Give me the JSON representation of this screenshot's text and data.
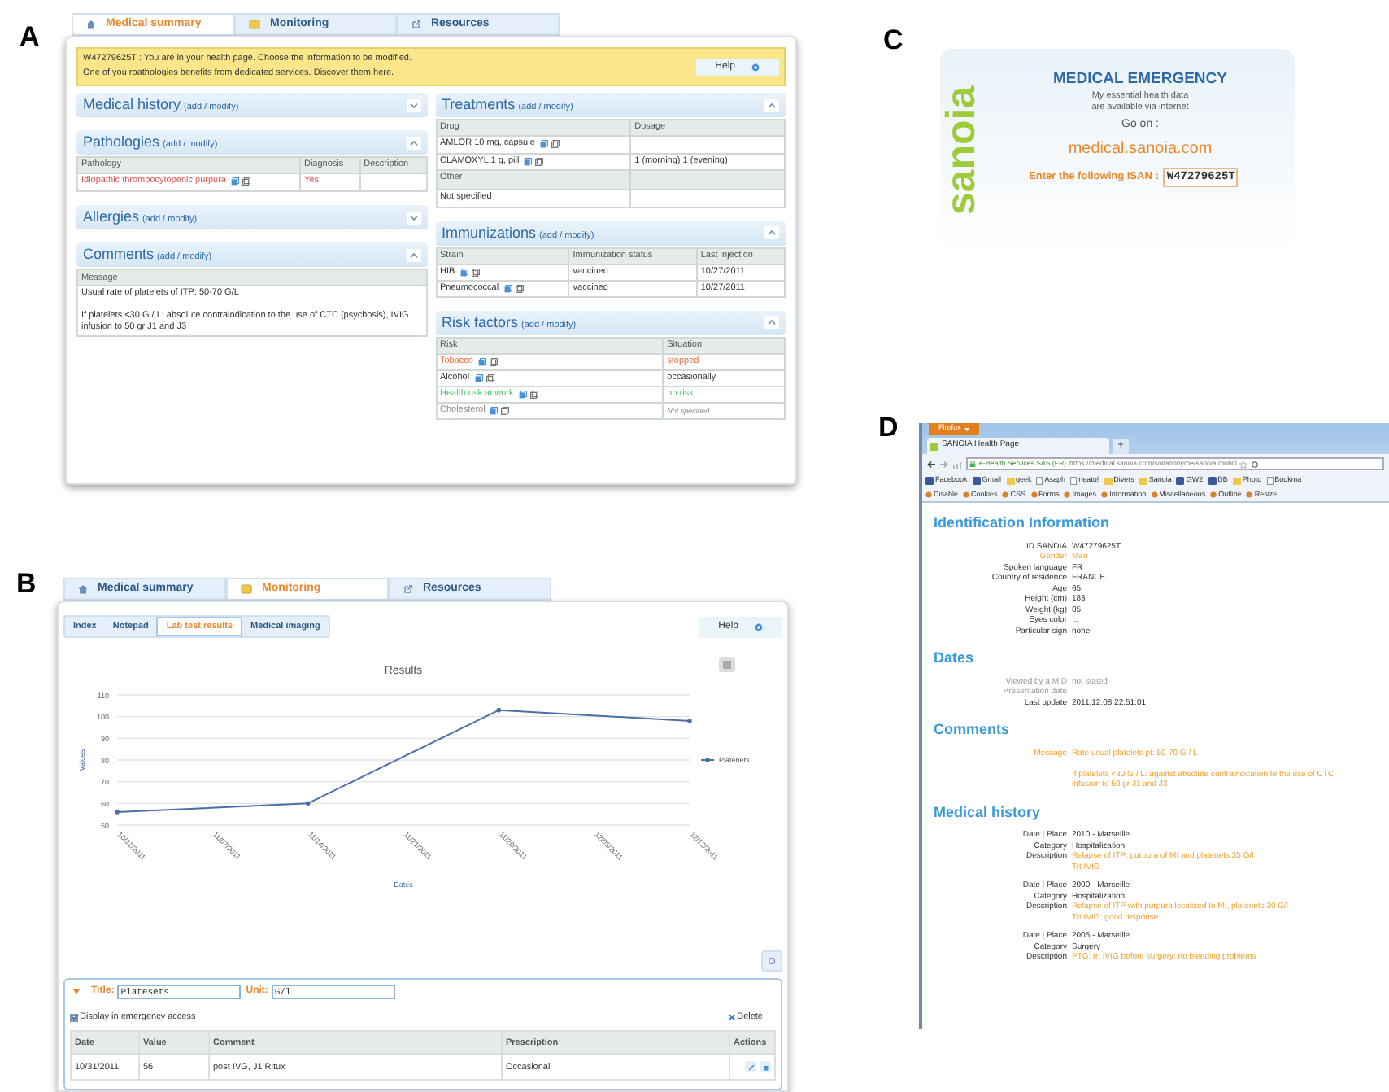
{
  "panel_labels": [
    "A",
    "B",
    "C",
    "D"
  ],
  "panel_a": {
    "tabs": [
      {
        "label": "Medical summary",
        "selected": true,
        "kind": "home"
      },
      {
        "label": "Monitoring",
        "selected": false,
        "kind": "notes"
      },
      {
        "label": "Resources",
        "selected": false,
        "kind": "link"
      }
    ],
    "notice": {
      "lines": [
        "W47279625T : You are in your health page. Choose the information to be modified.",
        "One of you rpathologies benefits from dedicated services. Discover them here."
      ],
      "help": "Help"
    },
    "columns": [
      [
        {
          "title": "Medical history",
          "action": "(add / modify)",
          "expanded": false
        },
        {
          "title": "Pathologies",
          "action": "(add / modify)",
          "expanded": true,
          "table": {
            "columns": [
              "Pathology",
              "Diagnosis",
              "Description"
            ],
            "rows": [
              {
                "kind": "data",
                "cells": [
                  "Idiopathic thrombocytopenic purpura",
                  "Yes"
                ],
                "icons": true,
                "color": "#d9534f"
              }
            ]
          }
        },
        {
          "title": "Allergies",
          "action": "(add / modify)",
          "expanded": false
        },
        {
          "title": "Comments",
          "action": "(add / modify)",
          "expanded": true,
          "table": {
            "columns": [
              "Message"
            ],
            "rows": [
              {
                "kind": "data",
                "cells": [
                  "Usual rate of platelets of ITP: 50-70 G/L\n\nIf platelets <30 G / L: absolute contraindication to the use of CTC (psychosis), IVIG infusion to 50 gr J1 and J3"
                ],
                "icons": false
              }
            ]
          }
        }
      ],
      [
        {
          "title": "Treatments",
          "action": "(add / modify)",
          "expanded": true,
          "table": {
            "columns": [
              "Drug",
              "Dosage"
            ],
            "rows": [
              {
                "kind": "data",
                "cells": [
                  "AMLOR 10 mg, capsule"
                ],
                "icons": true
              },
              {
                "kind": "data",
                "cells": [
                  "CLAMOXYL 1 g, pill",
                  "1 (morning) 1 (evening)"
                ],
                "icons": true
              },
              {
                "kind": "subheader",
                "cells": [
                  "Other"
                ],
                "icons": false
              },
              {
                "kind": "data",
                "cells": [
                  "Not specified"
                ],
                "icons": false
              }
            ]
          }
        },
        {
          "title": "Immunizations",
          "action": "(add / modify)",
          "expanded": true,
          "table": {
            "columns": [
              "Strain",
              "Immunization status",
              "Last injection"
            ],
            "rows": [
              {
                "kind": "data",
                "cells": [
                  "HIB",
                  "vaccined",
                  "10/27/2011"
                ],
                "icons": true
              },
              {
                "kind": "data",
                "cells": [
                  "Pneumococcal",
                  "vaccined",
                  "10/27/2011"
                ],
                "icons": true
              }
            ]
          }
        },
        {
          "title": "Risk factors",
          "action": "(add / modify)",
          "expanded": true,
          "table": {
            "columns": [
              "Risk",
              "Situation"
            ],
            "rows": [
              {
                "kind": "data",
                "cells": [
                  "Tobacco",
                  "stopped"
                ],
                "icons": true,
                "color": "#e0703c"
              },
              {
                "kind": "data",
                "cells": [
                  "Alcohol",
                  "occasionally"
                ],
                "icons": true,
                "color": "#333333"
              },
              {
                "kind": "data",
                "cells": [
                  "Health risk at work",
                  "no risk"
                ],
                "icons": true,
                "color": "#4cc46a"
              },
              {
                "kind": "muted",
                "cells": [
                  "Cholesterol",
                  "Not specified"
                ],
                "icons": true,
                "color": "#8a8a8a"
              }
            ]
          }
        }
      ]
    ]
  },
  "panel_b": {
    "tabs": [
      {
        "label": "Medical summary",
        "selected": false,
        "kind": "home"
      },
      {
        "label": "Monitoring",
        "selected": true,
        "kind": "notes"
      },
      {
        "label": "Resources",
        "selected": false,
        "kind": "link"
      }
    ],
    "subtabs": [
      {
        "label": "Index",
        "selected": false
      },
      {
        "label": "Notepad",
        "selected": false
      },
      {
        "label": "Lab test results",
        "selected": true
      },
      {
        "label": "Medical imaging",
        "selected": false
      }
    ],
    "help": "Help",
    "chart_data": {
      "type": "line",
      "grid": true,
      "title": "Results",
      "xlabel": "Dates",
      "ylabel": "Values",
      "categories": [
        "10/31/2011",
        "11/07/2011",
        "11/14/2011",
        "11/21/2011",
        "11/28/2011",
        "12/05/2011",
        "12/12/2011"
      ],
      "ylim": [
        50,
        110
      ],
      "yticks": [
        50,
        60,
        70,
        80,
        90,
        100,
        110
      ],
      "series": [
        {
          "name": "Platenets",
          "color": "#4a6fa5",
          "values": [
            56,
            null,
            60,
            null,
            103,
            null,
            98
          ]
        }
      ]
    },
    "editor": {
      "expanded": true,
      "title_label": "Title:",
      "title_value": "Platesets",
      "unit_label": "Unit:",
      "unit_value": "G/l",
      "emergency": {
        "label": "Display in emergency access",
        "checked": true
      },
      "delete": "Delete",
      "columns": [
        "Date",
        "Value",
        "Comment",
        "Prescription",
        "Actions"
      ],
      "rows": [
        [
          "10/31/2011",
          "56",
          "post IVG, J1 Ritux",
          "Occasional"
        ]
      ]
    }
  },
  "panel_c": {
    "logo": "sanoia",
    "title": "MEDICAL EMERGENCY",
    "lines": [
      "My essential health data",
      "are available via internet"
    ],
    "go_on": "Go on :",
    "url": "medical.sanoia.com",
    "isan_label": "Enter the following ISAN :",
    "isan": "W47279625T"
  },
  "panel_d": {
    "menu_button": "Firefox",
    "tab_title": "SANOIA Health Page",
    "new_tab": "+",
    "identity": "e-Health Services SAS (FR)",
    "url": "https://medical.sanoia.com/sol/anonyme/sanoia.mobi/l",
    "bookmarks": [
      {
        "label": "Facebook",
        "kind": "site"
      },
      {
        "label": "Gmail",
        "kind": "site"
      },
      {
        "label": "geek",
        "kind": "folder"
      },
      {
        "label": "Asaph",
        "kind": "page"
      },
      {
        "label": "neato!",
        "kind": "page"
      },
      {
        "label": "Divers",
        "kind": "folder"
      },
      {
        "label": "Sanoia",
        "kind": "folder"
      },
      {
        "label": "GW2",
        "kind": "site"
      },
      {
        "label": "DB",
        "kind": "site"
      },
      {
        "label": "Photo",
        "kind": "folder"
      },
      {
        "label": "Bookma",
        "kind": "page"
      }
    ],
    "tools": [
      "Disable",
      "Cookies",
      "CSS",
      "Forms",
      "Images",
      "Information",
      "Miscellaneous",
      "Outline",
      "Resize"
    ],
    "sections": [
      {
        "heading": "Identification Information",
        "groups": [
          [
            {
              "label": "ID SANDIA",
              "value": "W47279625T",
              "kind": "normal"
            },
            {
              "label": "Gender",
              "value": "Man",
              "kind": "highlight"
            },
            {
              "label": "Spoken language",
              "value": "FR",
              "kind": "normal"
            },
            {
              "label": "Country of residence",
              "value": "FRANCE",
              "kind": "normal"
            },
            {
              "label": "Age",
              "value": "65",
              "kind": "normal"
            },
            {
              "label": "Height (cm)",
              "value": "183",
              "kind": "normal"
            },
            {
              "label": "Weight (kg)",
              "value": "85",
              "kind": "normal"
            },
            {
              "label": "Eyes color",
              "value": "...",
              "kind": "normal"
            },
            {
              "label": "Particular sign",
              "value": "none",
              "kind": "normal"
            }
          ]
        ]
      },
      {
        "heading": "Dates",
        "groups": [
          [
            {
              "label": "Viewed by a M.D",
              "value": "not stated",
              "kind": "muted"
            },
            {
              "label": "Presentation date",
              "kind": "muted"
            },
            {
              "label": "Last update",
              "value": "2011.12.08 22:51:01",
              "kind": "normal"
            }
          ]
        ]
      },
      {
        "heading": "Comments",
        "groups": [
          [
            {
              "label": "Message",
              "value": "Rate usual platelets pt: 50-70 G / L\n\nIf platelets <30 G / L: against absolute contraindication to the use of CTC\ninfusion to 50 gr J1 and J3",
              "kind": "highlight"
            }
          ]
        ]
      },
      {
        "heading": "Medical history",
        "groups": [
          [
            {
              "label": "Date | Place",
              "value": "2010 - Marseille",
              "kind": "normal"
            },
            {
              "label": "Category",
              "value": "Hospitalization",
              "kind": "normal"
            },
            {
              "label": "Description",
              "value": "Relapse of ITP: purpura of MI and platenets 35 G/l\nTrt IVIG",
              "kind": "value-highlight"
            }
          ],
          [
            {
              "label": "Date | Place",
              "value": "2000 - Marseille",
              "kind": "normal"
            },
            {
              "label": "Category",
              "value": "Hospitalization",
              "kind": "normal"
            },
            {
              "label": "Description",
              "value": "Relapse of ITP with purpura localized to MI, platenets 30 G/l\nTrt IVIG: good response",
              "kind": "value-highlight"
            }
          ],
          [
            {
              "label": "Date | Place",
              "value": "2005 - Marseille",
              "kind": "normal"
            },
            {
              "label": "Category",
              "value": "Surgery",
              "kind": "normal"
            },
            {
              "label": "Description",
              "value": "PTG: trt IVIG before surgery: no bleeding problems",
              "kind": "value-highlight"
            }
          ]
        ]
      }
    ]
  }
}
